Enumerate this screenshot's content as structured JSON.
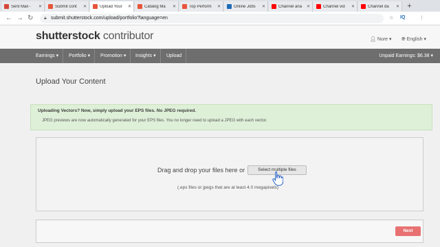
{
  "browser": {
    "tabs": [
      {
        "label": "Sent Mail -",
        "favicon_color": "#d44638"
      },
      {
        "label": "Submit cont",
        "favicon_color": "#e8543b"
      },
      {
        "label": "Upload Your",
        "favicon_color": "#e8543b"
      },
      {
        "label": "Catalog Ma",
        "favicon_color": "#e8543b"
      },
      {
        "label": "Top Perform",
        "favicon_color": "#e8543b"
      },
      {
        "label": "Online Jobs",
        "favicon_color": "#1e6bb8"
      },
      {
        "label": "Channel ana",
        "favicon_color": "#ff0000"
      },
      {
        "label": "Channel vid",
        "favicon_color": "#ff0000"
      },
      {
        "label": "Channel da",
        "favicon_color": "#ff0000"
      }
    ],
    "active_tab": 2,
    "new_tab_label": "+",
    "url": "submit.shutterstock.com/upload/portfolio?language=en",
    "back_label": "←",
    "forward_label": "→",
    "reload_label": "↻",
    "extensions": [
      "☆",
      "IQ",
      "⋮"
    ]
  },
  "header": {
    "logo_brand": "shutterstock",
    "logo_suffix": "contributor",
    "user_label": "Nure",
    "language_label": "English"
  },
  "nav": {
    "items": [
      "Earnings",
      "Portfolio",
      "Promotion",
      "Insights",
      "Upload"
    ],
    "unpaid_label": "Unpaid Earnings: $6.38"
  },
  "main": {
    "title": "Upload Your Content",
    "notice_heading": "Uploading Vectors? Now, simply upload your EPS files. No JPEG required.",
    "notice_body": "JPEG previews are now automatically generated for your EPS files. You no longer need to upload a JPEG with each vector.",
    "drop_text": "Drag and drop your files here or",
    "select_button": "Select multiple files",
    "hint": "(.eps files or jpegs that are at least 4.0 megapixels)",
    "next_button": "Next"
  },
  "colors": {
    "accent": "#e87171",
    "nav_bg": "#6e6e6e",
    "notice_bg": "#dff0d8"
  }
}
